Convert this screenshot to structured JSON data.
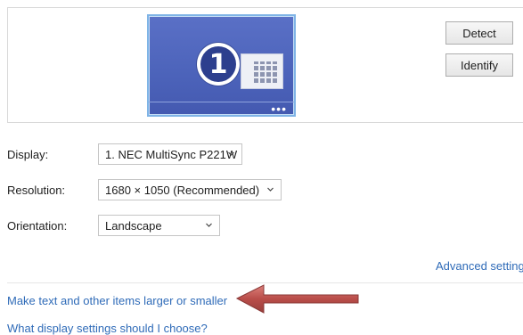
{
  "preview": {
    "monitor_number": "1",
    "dots": "•••"
  },
  "buttons": {
    "detect": "Detect",
    "identify": "Identify"
  },
  "settings": {
    "display_label": "Display:",
    "display_value": "1. NEC MultiSync P221W",
    "resolution_label": "Resolution:",
    "resolution_value": "1680 × 1050 (Recommended)",
    "orientation_label": "Orientation:",
    "orientation_value": "Landscape"
  },
  "links": {
    "advanced": "Advanced settings",
    "text_size": "Make text and other items larger or smaller",
    "which_settings": "What display settings should I choose?"
  },
  "colors": {
    "monitor": "#4c63ba",
    "link": "#2f6bb8",
    "arrow": "#b23a36"
  }
}
